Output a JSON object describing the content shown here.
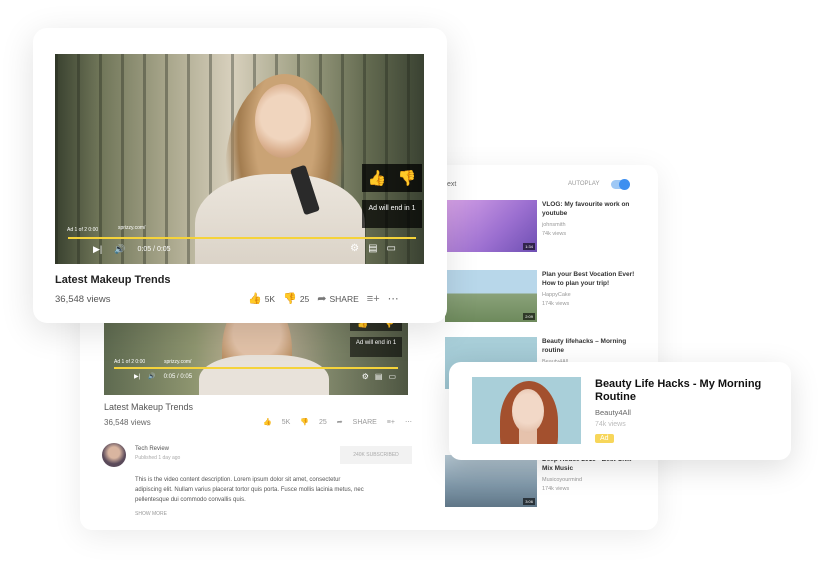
{
  "main_video": {
    "ad_counter": "Ad 1 of 2 0:00",
    "ad_source": "sprizzy.com/",
    "ad_will_end": "Ad will end in 1",
    "time": "0:05 / 0:05",
    "progress": 1.0,
    "title": "Latest Makeup Trends",
    "views": "36,548 views",
    "likes": "5K",
    "dislikes": "25",
    "share_label": "SHARE"
  },
  "background_page": {
    "ad_counter": "Ad 1 of 2 0:00",
    "ad_source": "sprizzy.com/",
    "ad_will_end": "Ad will end in 1",
    "time": "0:05 / 0:05",
    "title": "Latest Makeup Trends",
    "views": "36,548 views",
    "likes": "5K",
    "dislikes": "25",
    "share_label": "SHARE",
    "channel_name": "Tech Review",
    "published": "Published 1 day ago",
    "subscribe_label": "240K SUBSCRIBED",
    "description": "This is the video content description. Lorem ipsum dolor sit amet, consectetur adipiscing elit. Nullam varius placerat tortor quis porta. Fusce mollis lacinia metus, nec pellentesque dui commodo convallis quis.",
    "show_more": "SHOW MORE",
    "next_label": "ext",
    "autoplay_label": "AUTOPLAY",
    "recommendations": [
      {
        "title": "VLOG: My favourite work on youtube",
        "channel": "johnsmith",
        "views": "74k views",
        "duration": "1:34"
      },
      {
        "title": "Plan your Best Vocation Ever! How to plan your trip!",
        "channel": "HappyCake",
        "views": "174k views",
        "duration": "2:09"
      },
      {
        "title": "Beauty lifehacks – Morning routine",
        "channel": "Beauty4All",
        "views": "",
        "duration": ""
      },
      {
        "title": "Deep House 2019 - Best Chill Mix Music",
        "channel": "Musicoyourmind",
        "views": "174k views",
        "duration": "3:06"
      }
    ]
  },
  "highlight_card": {
    "title": "Beauty Life Hacks - My Morning Routine",
    "channel": "Beauty4All",
    "views": "74k views",
    "badge": "Ad"
  },
  "colors": {
    "accent_yellow": "#f5d33a",
    "toggle_blue": "#3d8ff0"
  }
}
